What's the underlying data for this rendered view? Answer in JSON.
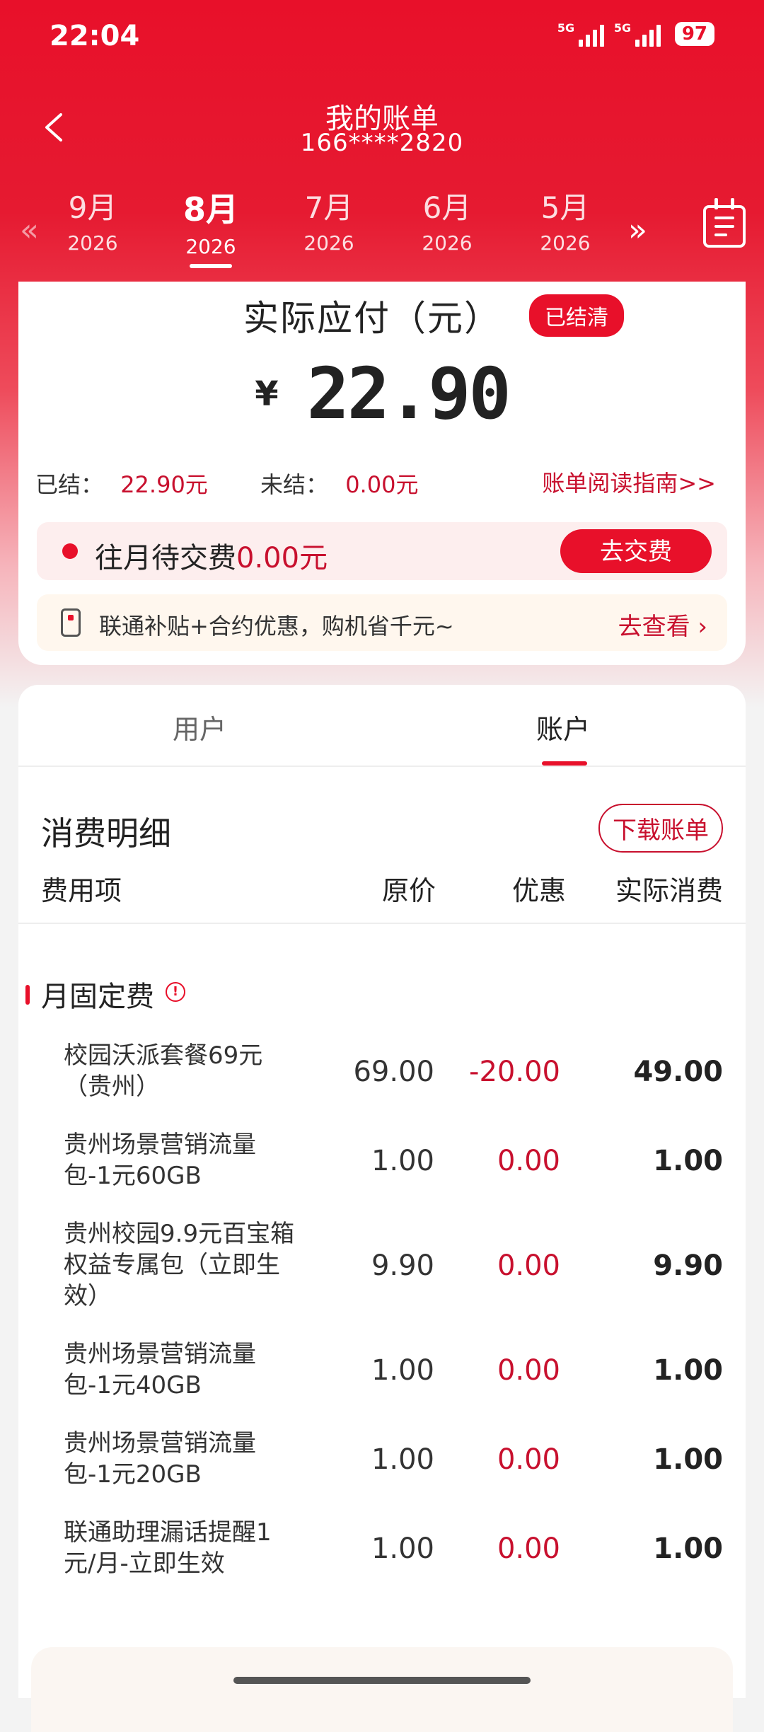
{
  "status_bar": {
    "time": "22:04",
    "sim1": "5G",
    "sim2": "5G",
    "battery": "97"
  },
  "header": {
    "title": "我的账单",
    "phone": "166****2820"
  },
  "months": [
    {
      "month": "9月",
      "year": "2026",
      "active": false
    },
    {
      "month": "8月",
      "year": "2026",
      "active": true
    },
    {
      "month": "7月",
      "year": "2026",
      "active": false
    },
    {
      "month": "6月",
      "year": "2026",
      "active": false
    },
    {
      "month": "5月",
      "year": "2026",
      "active": false
    }
  ],
  "summary": {
    "title": "实际应付（元）",
    "badge": "已结清",
    "currency": "¥",
    "amount": "22.90",
    "settled_label": "已结：",
    "settled_value": "22.90元",
    "unsettled_label": "未结：",
    "unsettled_value": "0.00元",
    "guide_link": "账单阅读指南>>"
  },
  "due": {
    "label": "往月待交费",
    "value": "0.00元",
    "button": "去交费"
  },
  "promo": {
    "text": "联通补贴+合约优惠，购机省千元~",
    "link": "去查看 ›"
  },
  "tabs": [
    "用户",
    "账户"
  ],
  "detail": {
    "title": "消费明细",
    "download": "下载账单",
    "columns": [
      "费用项",
      "原价",
      "优惠",
      "实际消费"
    ],
    "group": "月固定费",
    "rows": [
      {
        "name": "校园沃派套餐69元（贵州）",
        "orig": "69.00",
        "disc": "-20.00",
        "act": "49.00"
      },
      {
        "name": "贵州场景营销流量包-1元60GB",
        "orig": "1.00",
        "disc": "0.00",
        "act": "1.00"
      },
      {
        "name": "贵州校园9.9元百宝箱权益专属包（立即生效）",
        "orig": "9.90",
        "disc": "0.00",
        "act": "9.90"
      },
      {
        "name": "贵州场景营销流量包-1元40GB",
        "orig": "1.00",
        "disc": "0.00",
        "act": "1.00"
      },
      {
        "name": "贵州场景营销流量包-1元20GB",
        "orig": "1.00",
        "disc": "0.00",
        "act": "1.00"
      },
      {
        "name": "联通助理漏话提醒1元/月-立即生效",
        "orig": "1.00",
        "disc": "0.00",
        "act": "1.00"
      }
    ]
  },
  "colors": {
    "brand_red": "#e8102a",
    "text_red": "#c8102e"
  }
}
